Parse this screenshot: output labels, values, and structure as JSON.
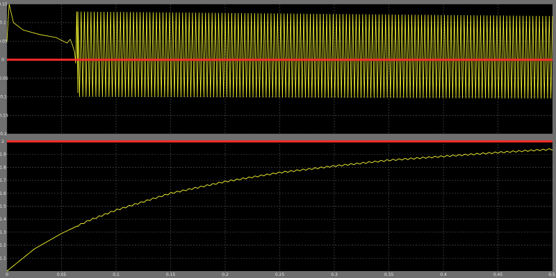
{
  "chart_data": [
    {
      "type": "line",
      "title": "",
      "xlabel": "",
      "ylabel": "",
      "xlim": [
        0,
        0.5
      ],
      "ylim": [
        -0.2,
        0.15
      ],
      "grid": true,
      "background": "#000000",
      "xticks": [
        0,
        0.05,
        0.1,
        0.15,
        0.2,
        0.25,
        0.3,
        0.35,
        0.4,
        0.45,
        0.5
      ],
      "yticks": [
        -0.2,
        -0.15,
        -0.1,
        -0.05,
        0,
        0.05,
        0.1,
        0.15
      ],
      "ytick_labels": [
        "-0.2",
        "-0.15",
        "-0.1",
        "-0.05",
        "0",
        "0.05",
        "0.1",
        "0.15"
      ],
      "series": [
        {
          "color": "#ffff33",
          "kind": "oscillating",
          "x": [
            0,
            0.002,
            0.006,
            0.015,
            0.03,
            0.045,
            0.055,
            0.058,
            0.06,
            0.062,
            0.063,
            0.064,
            0.065,
            0.5
          ],
          "y": [
            0.05,
            0.15,
            0.1,
            0.08,
            0.068,
            0.06,
            0.045,
            0.055,
            0.04,
            0.02,
            -0.01,
            0.13,
            -0.09,
            0.0
          ],
          "oscillation_start": 0.065,
          "oscillation_upper": 0.13,
          "oscillation_lower": -0.1,
          "oscillation_period": 0.003,
          "oscillation_upper_end": 0.118,
          "oscillation_lower_end": -0.105
        },
        {
          "color": "#ff2a2a",
          "kind": "reference",
          "x": [
            0,
            0.5
          ],
          "y": [
            0,
            0
          ]
        }
      ]
    },
    {
      "type": "line",
      "title": "",
      "xlabel": "",
      "ylabel": "",
      "xlim": [
        0,
        0.5
      ],
      "ylim": [
        1.0,
        2.0
      ],
      "grid": true,
      "background": "#000000",
      "xticks": [
        0,
        0.05,
        0.1,
        0.15,
        0.2,
        0.25,
        0.3,
        0.35,
        0.4,
        0.45,
        0.5
      ],
      "xtick_labels": [
        "0",
        "0.05",
        "0.1",
        "0.15",
        "0.2",
        "0.25",
        "0.3",
        "0.35",
        "0.4",
        "0.45",
        "0.5"
      ],
      "yticks": [
        1.1,
        1.2,
        1.3,
        1.4,
        1.5,
        1.6,
        1.7,
        1.8,
        1.9,
        2.0
      ],
      "ytick_labels": [
        "1.1",
        "1.2",
        "1.3",
        "1.4",
        "1.5",
        "1.6",
        "1.7",
        "1.8",
        "1.9",
        "2"
      ],
      "series": [
        {
          "color": "#ffff33",
          "kind": "rising",
          "x": [
            0,
            0.025,
            0.05,
            0.075,
            0.1,
            0.15,
            0.2,
            0.25,
            0.3,
            0.35,
            0.4,
            0.45,
            0.5
          ],
          "y": [
            1.0,
            1.17,
            1.29,
            1.39,
            1.47,
            1.6,
            1.69,
            1.76,
            1.81,
            1.855,
            1.885,
            1.915,
            1.94
          ],
          "ripple_start": 0.065,
          "ripple_amplitude": 0.012,
          "ripple_period": 0.0055
        },
        {
          "color": "#ff2a2a",
          "kind": "reference",
          "x": [
            0,
            0.5
          ],
          "y": [
            2.0,
            2.0
          ]
        }
      ]
    }
  ]
}
